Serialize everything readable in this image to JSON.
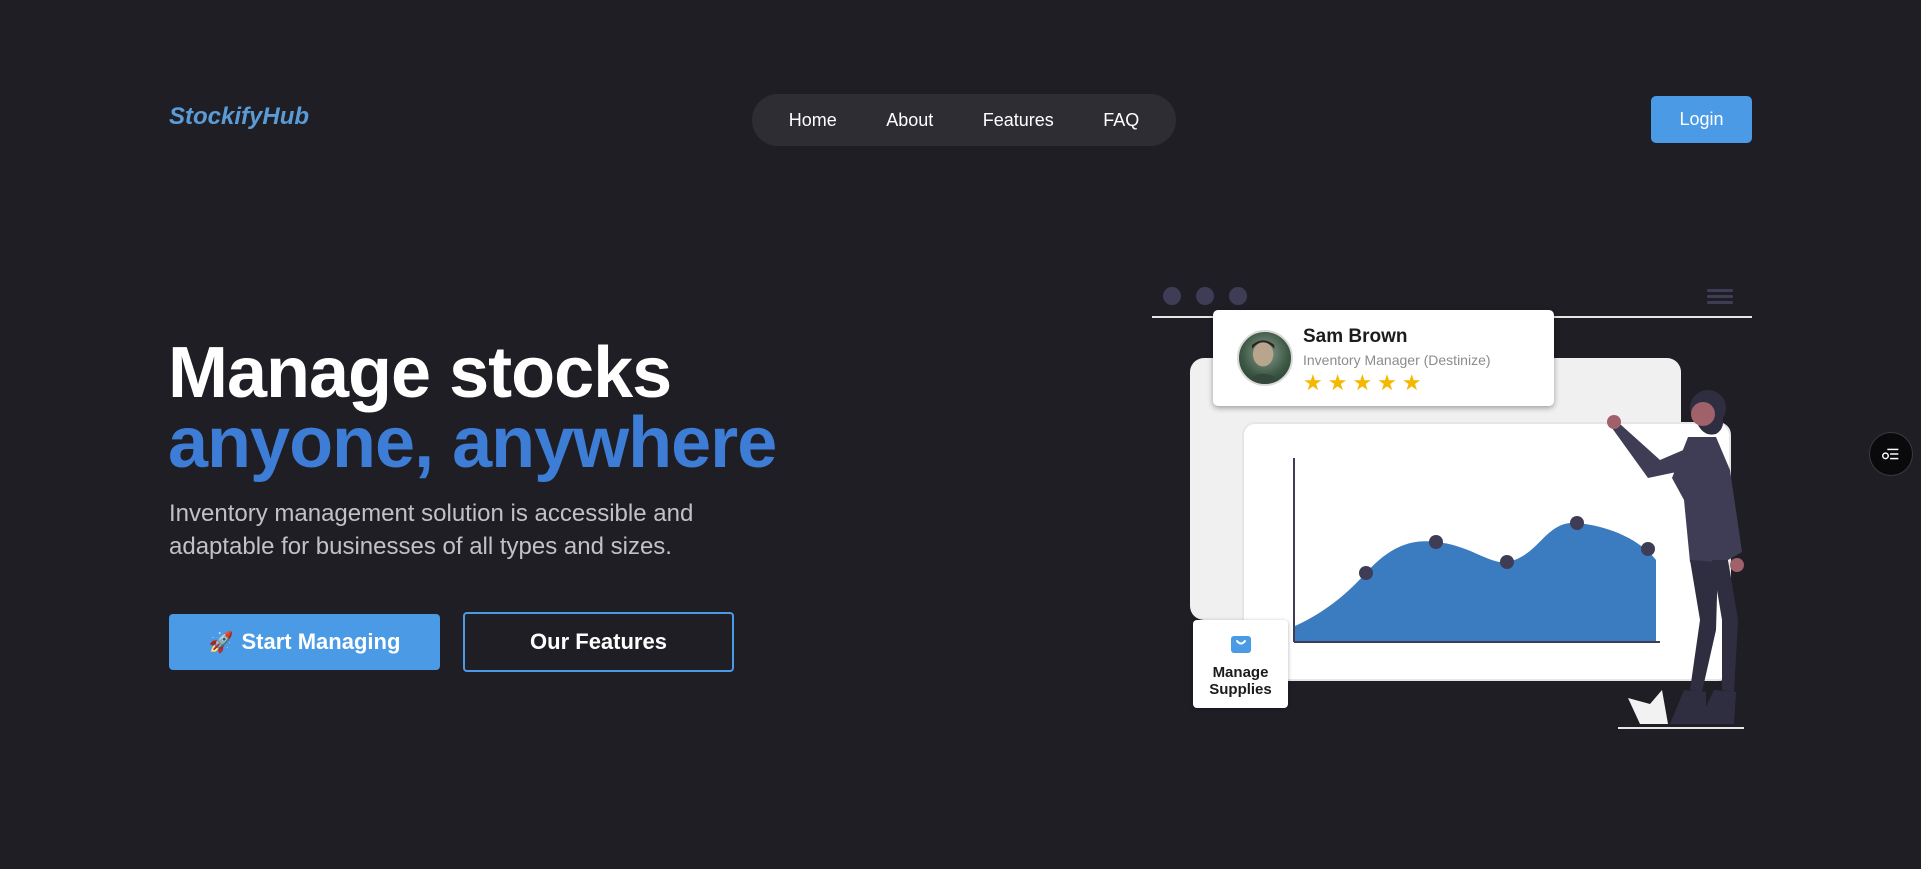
{
  "header": {
    "logo": "StockifyHub",
    "nav": [
      "Home",
      "About",
      "Features",
      "FAQ"
    ],
    "login_label": "Login"
  },
  "hero": {
    "title_line1": "Manage stocks",
    "title_line2": "anyone, anywhere",
    "subtitle": "Inventory management solution is accessible and adaptable for businesses of all types and sizes.",
    "primary_cta": "Start Managing",
    "primary_cta_icon": "🚀",
    "secondary_cta": "Our Features"
  },
  "testimonial": {
    "name": "Sam Brown",
    "role": "Inventory Manager (Destinize)",
    "rating": 5,
    "stars": "★★★★★"
  },
  "supplies_card": {
    "label": "Manage Supplies",
    "icon": "shopping-bag-icon"
  },
  "colors": {
    "background": "#1f1e25",
    "accent": "#4a9ae6",
    "heading_accent": "#3d7dd6",
    "chart_fill": "#3b7bbf",
    "star": "#f5b800"
  }
}
